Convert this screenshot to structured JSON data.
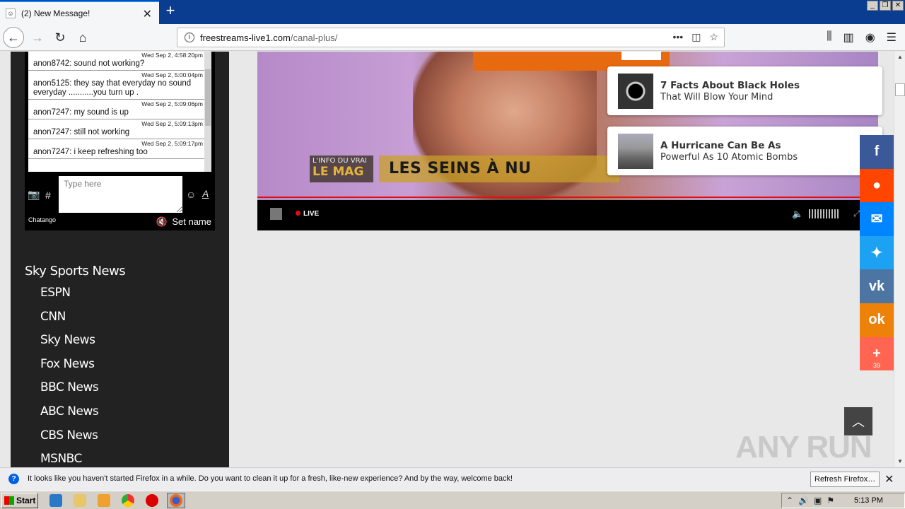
{
  "browser": {
    "tab_title": "(2) New Message!",
    "tab_close": "✕",
    "new_tab": "+",
    "url_domain": "freestreams-live1.com",
    "url_path": "/canal-plus/"
  },
  "chat": {
    "messages": [
      {
        "time": "Wed Sep 2, 4:58:20pm",
        "text": "anon8742: sound not working?"
      },
      {
        "time": "Wed Sep 2, 5:00:04pm",
        "text": "anon5125: they say that everyday no sound everyday ...........you turn up ."
      },
      {
        "time": "Wed Sep 2, 5:09:06pm",
        "text": "anon7247: my sound is up"
      },
      {
        "time": "Wed Sep 2, 5:09:13pm",
        "text": "anon7247: still not working"
      },
      {
        "time": "Wed Sep 2, 5:09:17pm",
        "text": "anon7247: i keep refreshing too"
      }
    ],
    "input_placeholder": "Type here",
    "brand": "Chatango",
    "set_name": "Set name",
    "hash": "#"
  },
  "channels": {
    "header": "Sky Sports News",
    "items": [
      "ESPN",
      "CNN",
      "Sky News",
      "Fox News",
      "BBC News",
      "ABC News",
      "CBS News",
      "MSNBC"
    ]
  },
  "video": {
    "tag_line1": "L'INFO DU VRAI",
    "tag_line2": "LE MAG",
    "headline": "LES SEINS À NU",
    "live_label": "LIVE"
  },
  "recommendations": [
    {
      "title": "7 Facts About Black Holes",
      "subtitle": "That Will Blow Your Mind"
    },
    {
      "title": "A Hurricane Can Be As",
      "subtitle": "Powerful As 10 Atomic Bombs"
    }
  ],
  "share": {
    "buttons": [
      {
        "name": "facebook",
        "glyph": "f",
        "color": "#3b5998"
      },
      {
        "name": "reddit",
        "glyph": "●",
        "color": "#ff4500"
      },
      {
        "name": "messenger",
        "glyph": "✉",
        "color": "#0084ff"
      },
      {
        "name": "twitter",
        "glyph": "✦",
        "color": "#1da1f2"
      },
      {
        "name": "vk",
        "glyph": "vk",
        "color": "#4c75a3"
      },
      {
        "name": "odnoklassniki",
        "glyph": "ok",
        "color": "#ee8208"
      },
      {
        "name": "more",
        "glyph": "+",
        "color": "#ff6550"
      }
    ],
    "count": "39"
  },
  "watermark": "ANY RUN",
  "notification": {
    "text": "It looks like you haven't started Firefox in a while. Do you want to clean it up for a fresh, like-new experience? And by the way, welcome back!",
    "button": "Refresh Firefox…"
  },
  "taskbar": {
    "start": "Start",
    "time": "5:13 PM"
  }
}
